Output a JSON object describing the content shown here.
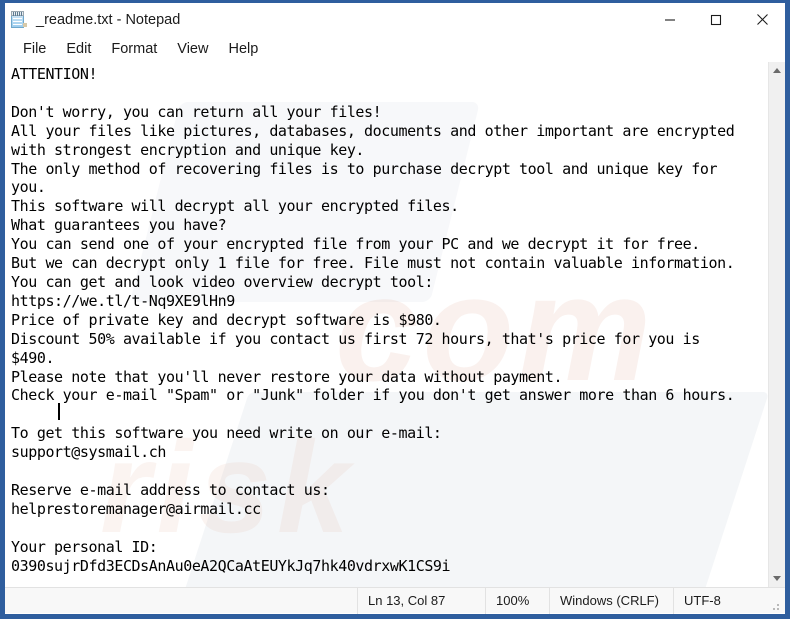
{
  "window": {
    "title": "_readme.txt - Notepad",
    "app_icon": "notepad-icon",
    "controls": {
      "minimize": "minimize-icon",
      "maximize": "maximize-icon",
      "close": "close-icon"
    },
    "frame_color": "#2f5e9e"
  },
  "menubar": {
    "items": [
      {
        "label": "File"
      },
      {
        "label": "Edit"
      },
      {
        "label": "Format"
      },
      {
        "label": "View"
      },
      {
        "label": "Help"
      }
    ]
  },
  "document": {
    "filename": "_readme.txt",
    "body": "ATTENTION!\n\nDon't worry, you can return all your files!\nAll your files like pictures, databases, documents and other important are encrypted\nwith strongest encryption and unique key.\nThe only method of recovering files is to purchase decrypt tool and unique key for\nyou.\nThis software will decrypt all your encrypted files.\nWhat guarantees you have?\nYou can send one of your encrypted file from your PC and we decrypt it for free.\nBut we can decrypt only 1 file for free. File must not contain valuable information.\nYou can get and look video overview decrypt tool:\nhttps://we.tl/t-Nq9XE9lHn9\nPrice of private key and decrypt software is $980.\nDiscount 50% available if you contact us first 72 hours, that's price for you is\n$490.\nPlease note that you'll never restore your data without payment.\nCheck your e-mail \"Spam\" or \"Junk\" folder if you don't get answer more than 6 hours.\n\nTo get this software you need write on our e-mail:\nsupport@sysmail.ch\n\nReserve e-mail address to contact us:\nhelprestoremanager@airmail.cc\n\nYour personal ID:\n0390sujrDfd3ECDsAnAu0eA2QCaAtEUYkJq7hk40vdrxwK1CS9i",
    "url": "https://we.tl/t-Nq9XE9lHn9",
    "price_full": "$980",
    "price_discount": "$490",
    "discount_percent": "50%",
    "discount_hours": "72 hours",
    "answer_hours": "6 hours",
    "email_primary": "support@sysmail.ch",
    "email_reserve": "helprestoremanager@airmail.cc",
    "personal_id": "0390sujrDfd3ECDsAnAu0eA2QCaAtEUYkJq7hk40vdrxwK1CS9i"
  },
  "scrollbar": {
    "up_icon": "scroll-up-arrow-icon",
    "down_icon": "scroll-down-arrow-icon"
  },
  "statusbar": {
    "line_col": "Ln 13, Col 87",
    "zoom": "100%",
    "line_ending": "Windows (CRLF)",
    "encoding": "UTF-8"
  },
  "watermark": {
    "text_a": "com",
    "text_b": "risk"
  }
}
